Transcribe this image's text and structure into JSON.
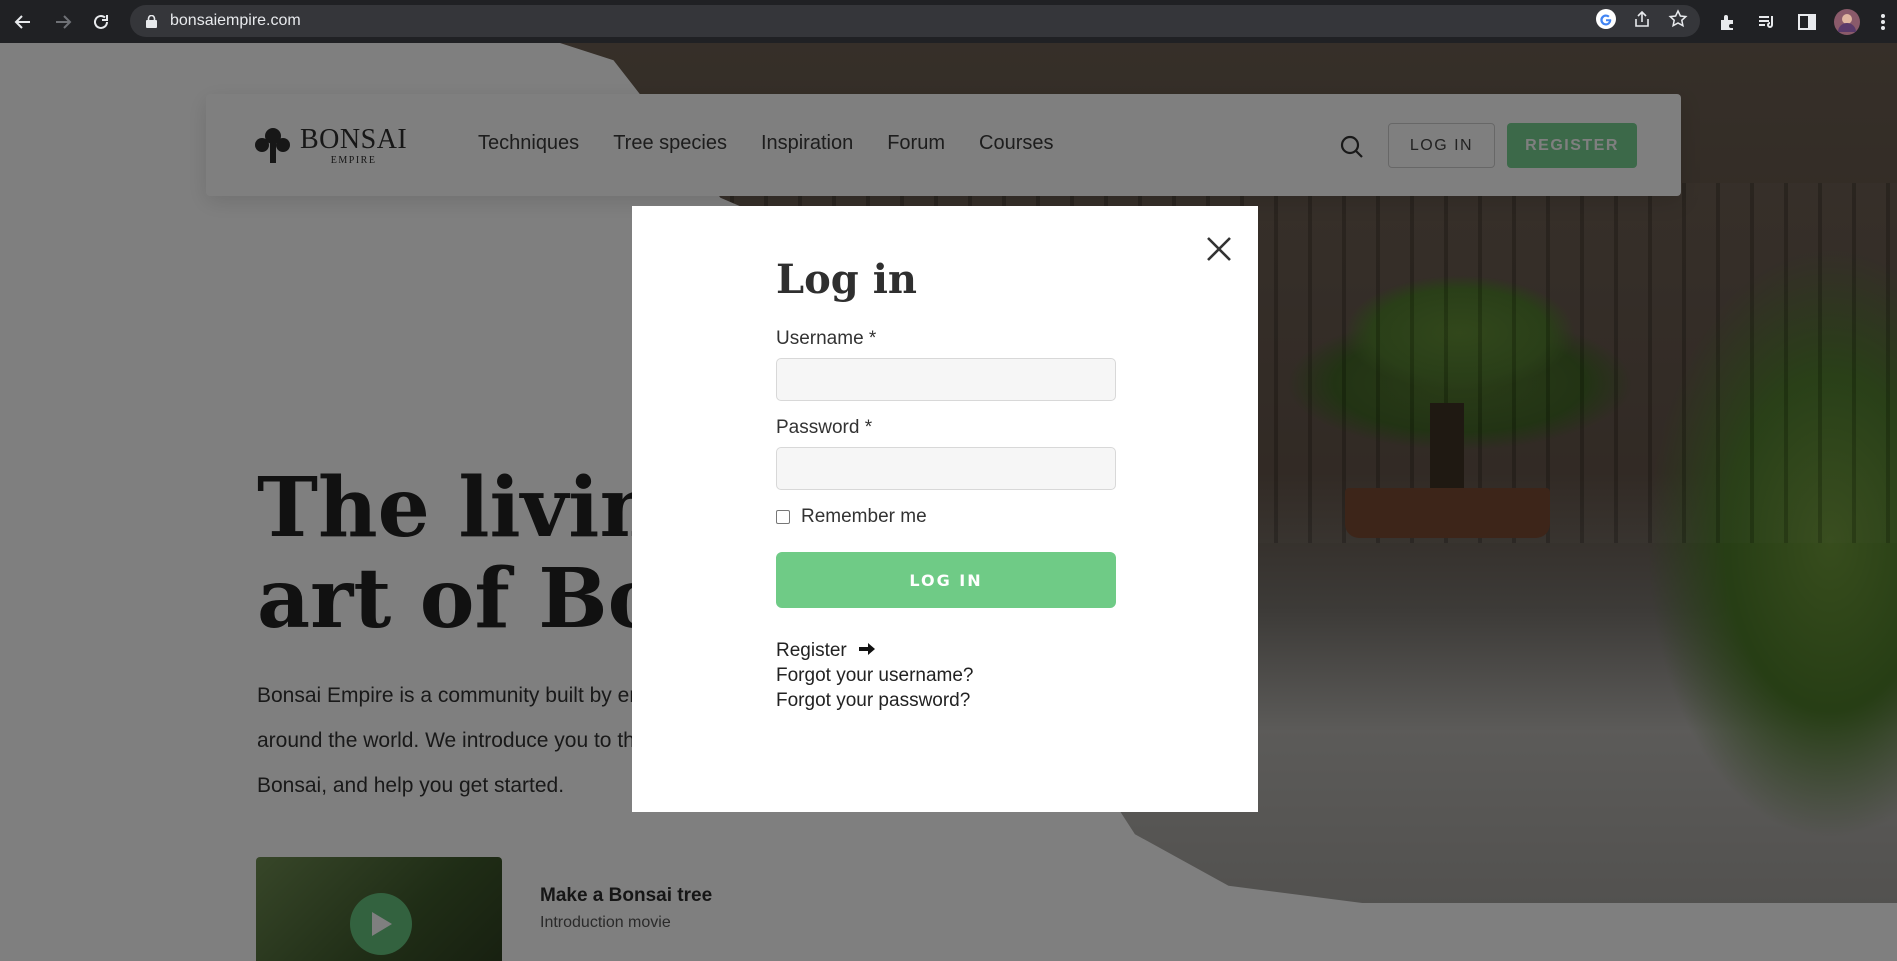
{
  "browser": {
    "url": "bonsaiempire.com"
  },
  "header": {
    "logo_main": "BONSAI",
    "logo_sub": "EMPIRE",
    "nav": [
      "Techniques",
      "Tree species",
      "Inspiration",
      "Forum",
      "Courses"
    ],
    "login_label": "LOG IN",
    "register_label": "REGISTER",
    "register_color": "#78d293"
  },
  "hero": {
    "title_line1": "The living",
    "title_line2": "art of Bonsai",
    "text": "Bonsai Empire is a community built by enthusiasts from around the world. We introduce you to the living art of Bonsai, and help you get started.",
    "video_title": "Make a Bonsai tree",
    "video_subtitle": "Introduction movie"
  },
  "modal": {
    "title": "Log in",
    "username_label": "Username *",
    "username_value": "",
    "password_label": "Password *",
    "password_value": "",
    "remember_label": "Remember me",
    "remember_checked": false,
    "submit_label": "LOG IN",
    "submit_color": "#6fcb86",
    "register_link": "Register",
    "forgot_username": "Forgot your username?",
    "forgot_password": "Forgot your password?"
  }
}
